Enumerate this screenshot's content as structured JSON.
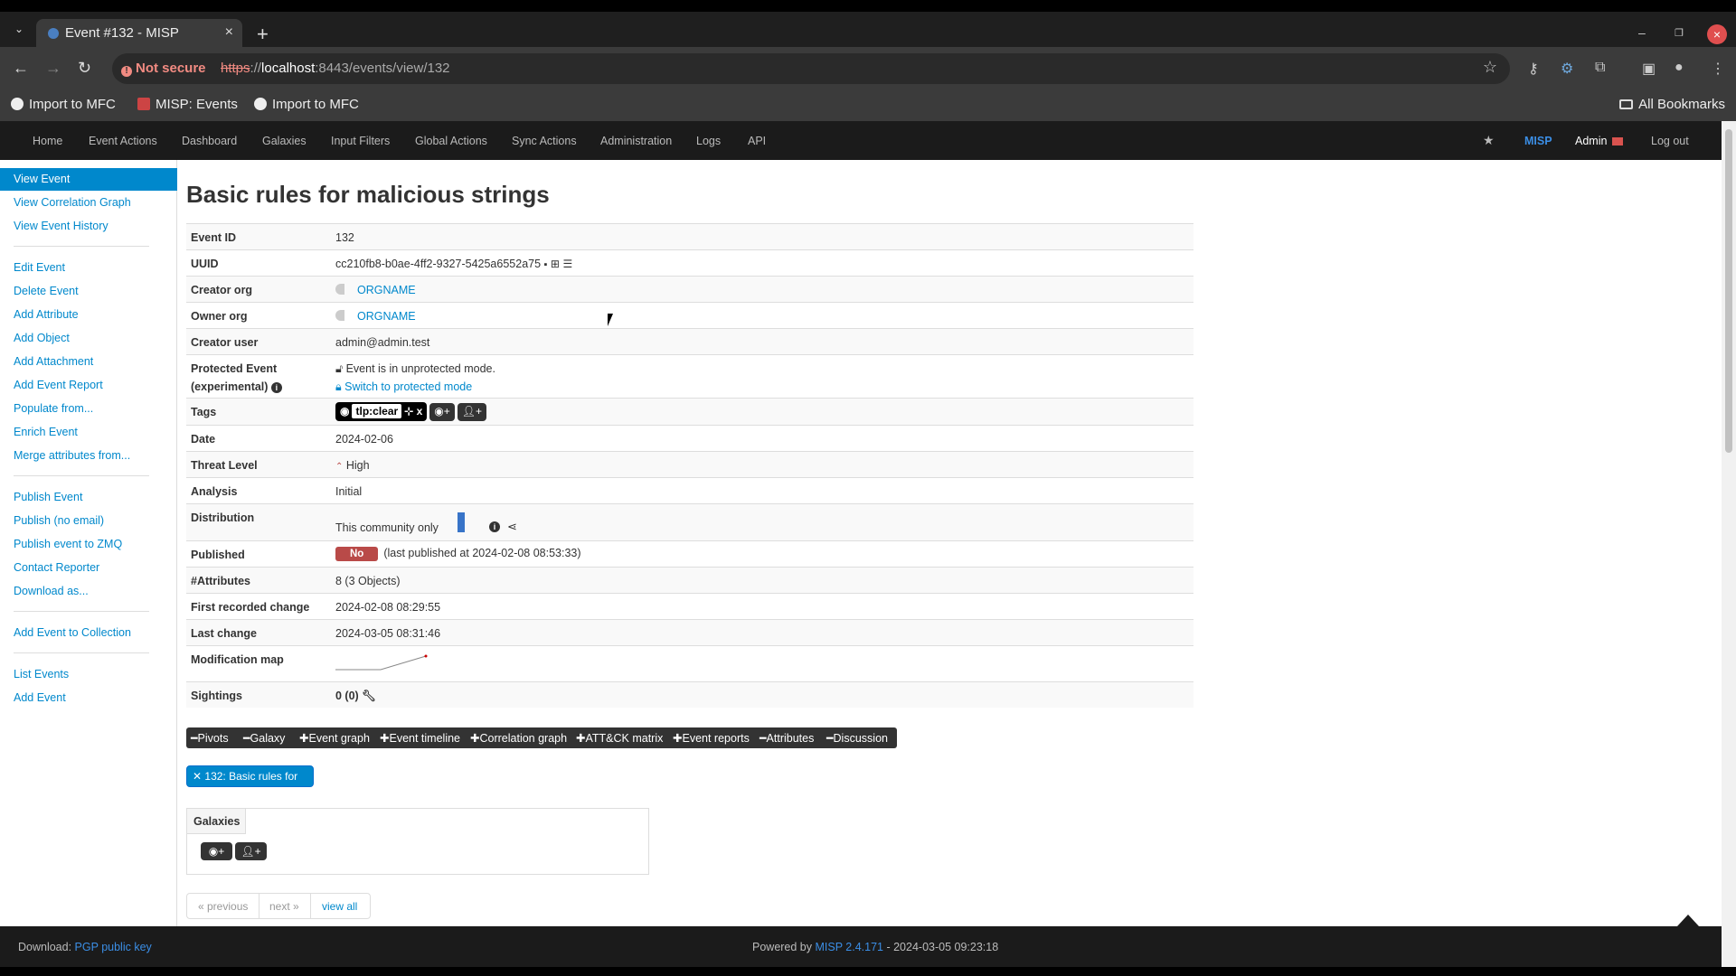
{
  "browser": {
    "tab_title": "Event #132 - MISP",
    "not_secure": "Not secure",
    "url_scheme": "https",
    "url_host": "localhost",
    "url_rest": ":8443/events/view/132",
    "bookmarks": [
      "Import to MFC",
      "MISP: Events",
      "Import to MFC"
    ],
    "all_bookmarks": "All Bookmarks"
  },
  "navbar": {
    "items": [
      "Home",
      "Event Actions",
      "Dashboard",
      "Galaxies",
      "Input Filters",
      "Global Actions",
      "Sync Actions",
      "Administration",
      "Logs",
      "API"
    ],
    "brand": "MISP",
    "user": "Admin",
    "logout": "Log out"
  },
  "sidebar": {
    "active": "View Event",
    "group1": [
      "View Correlation Graph",
      "View Event History"
    ],
    "group2": [
      "Edit Event",
      "Delete Event",
      "Add Attribute",
      "Add Object",
      "Add Attachment",
      "Add Event Report",
      "Populate from...",
      "Enrich Event",
      "Merge attributes from..."
    ],
    "group3": [
      "Publish Event",
      "Publish (no email)",
      "Publish event to ZMQ",
      "Contact Reporter",
      "Download as..."
    ],
    "group4": [
      "Add Event to Collection"
    ],
    "group5": [
      "List Events",
      "Add Event"
    ]
  },
  "event": {
    "title": "Basic rules for malicious strings",
    "labels": {
      "event_id": "Event ID",
      "uuid": "UUID",
      "creator_org": "Creator org",
      "owner_org": "Owner org",
      "creator_user": "Creator user",
      "protected_event": "Protected Event",
      "experimental": "(experimental)",
      "tags": "Tags",
      "date": "Date",
      "threat_level": "Threat Level",
      "analysis": "Analysis",
      "distribution": "Distribution",
      "published": "Published",
      "attributes": "#Attributes",
      "first_recorded": "First recorded change",
      "last_change": "Last change",
      "modification_map": "Modification map",
      "sightings": "Sightings"
    },
    "event_id": "132",
    "uuid": "cc210fb8-b0ae-4ff2-9327-5425a6552a75",
    "creator_org": "ORGNAME",
    "owner_org": "ORGNAME",
    "creator_user": "admin@admin.test",
    "protected_text": "Event is in unprotected mode.",
    "protected_switch": "Switch to protected mode",
    "tag": "tlp:clear",
    "tag_x": "x",
    "date": "2024-02-06",
    "threat_level": "High",
    "analysis": "Initial",
    "distribution": "This community only",
    "published_badge": "No",
    "published_text": "(last published at 2024-02-08 08:53:33)",
    "attributes": "8 (3 Objects)",
    "first_recorded": "2024-02-08 08:29:55",
    "last_change": "2024-03-05 08:31:46",
    "sightings": "0 (0)"
  },
  "tabs": [
    "Pivots",
    "Galaxy",
    "Event graph",
    "Event timeline",
    "Correlation graph",
    "ATT&CK matrix",
    "Event reports",
    "Attributes",
    "Discussion"
  ],
  "pivot_pill": "132: Basic rules for ...",
  "galaxies_label": "Galaxies",
  "pager": {
    "previous": "« previous",
    "next": "next »",
    "view_all": "view all"
  },
  "footer": {
    "download": "Download: ",
    "pgp": "PGP public key",
    "powered": "Powered by ",
    "version": "MISP 2.4.171",
    "timestamp": " - 2024-03-05 09:23:18"
  },
  "colors": {
    "accent": "#0088cc",
    "navbar": "#1b1b1b",
    "badge_no": "#b94a48"
  }
}
